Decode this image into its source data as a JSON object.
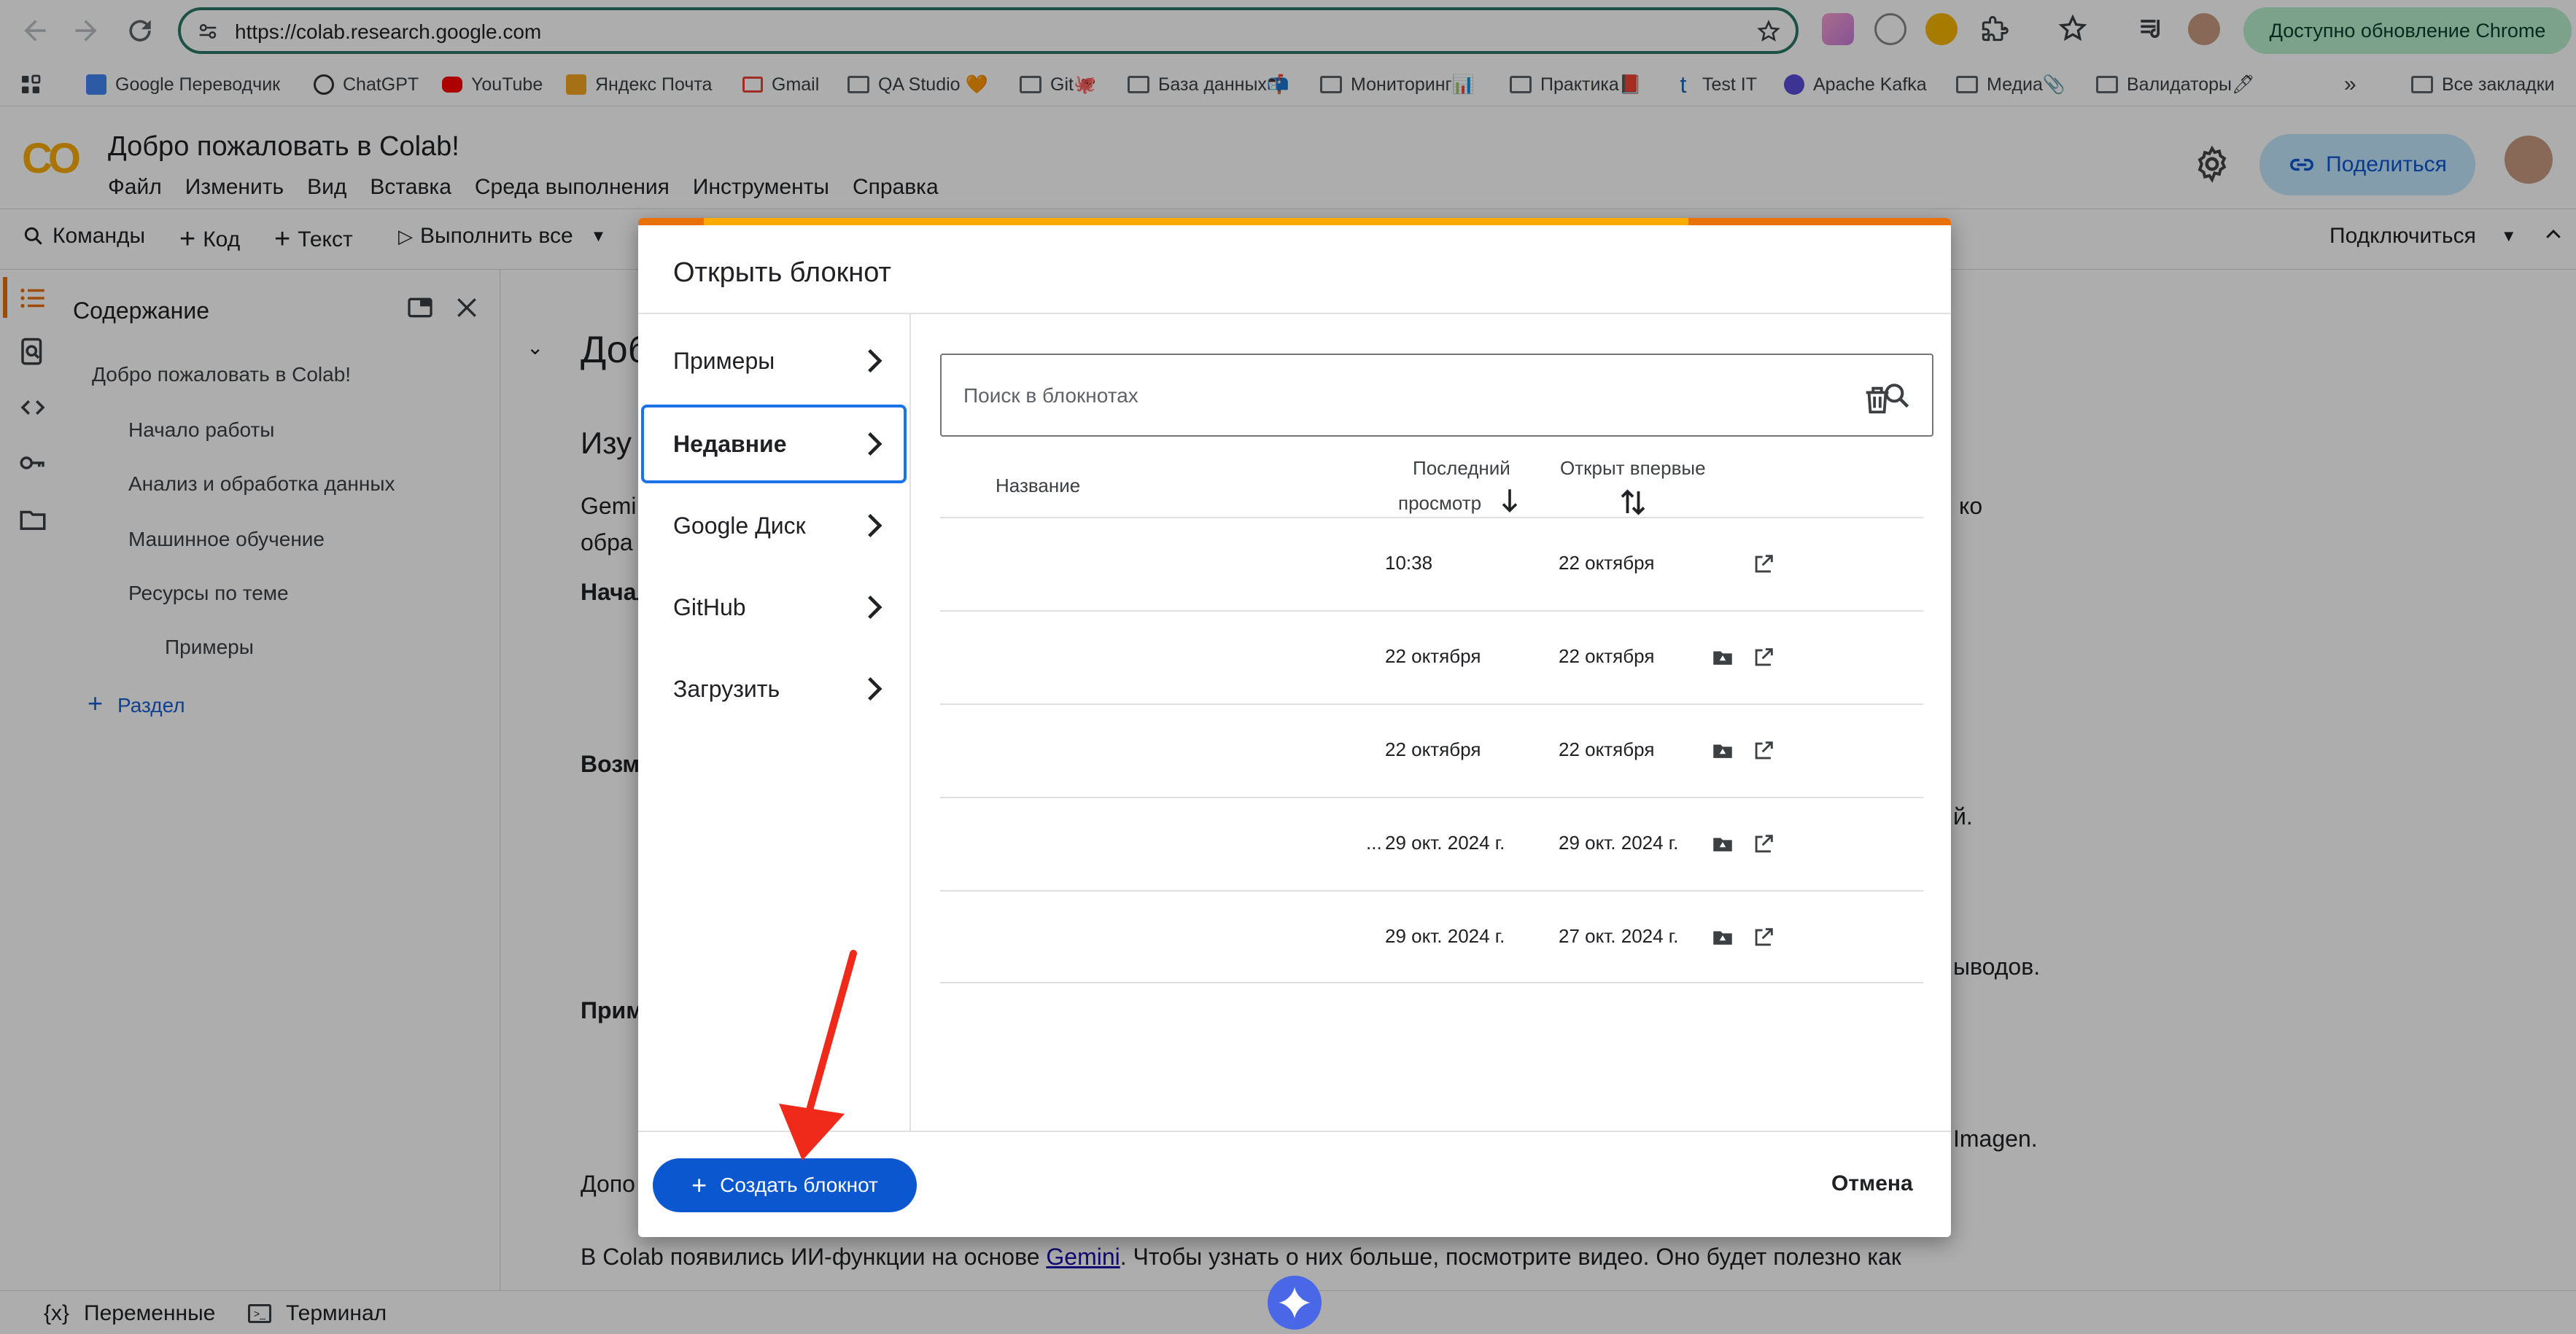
{
  "browser": {
    "url": "https://colab.research.google.com",
    "update_label": "Доступно обновление Chrome"
  },
  "bookmarks": {
    "items": [
      "Google Переводчик",
      "ChatGPT",
      "YouTube",
      "Яндекс Почта",
      "Gmail",
      "QA Studio 🧡",
      "Git🐙",
      "База данных📬",
      "Мониторинг📊",
      "Практика📕",
      "Test IT",
      "Apache Kafka",
      "Медиа📎",
      "Валидаторы🖊"
    ],
    "more": "»",
    "all": "Все закладки"
  },
  "colab": {
    "title": "Добро пожаловать в Colab!",
    "menu": [
      "Файл",
      "Изменить",
      "Вид",
      "Вставка",
      "Среда выполнения",
      "Инструменты",
      "Справка"
    ],
    "share_label": "Поделиться",
    "toolbar": {
      "commands": "Команды",
      "code": "Код",
      "text": "Текст",
      "run_all": "Выполнить все",
      "connect": "Подключиться"
    },
    "toc": {
      "title": "Содержание",
      "items": [
        "Добро пожаловать в Colab!",
        "Начало работы",
        "Анализ и обработка данных",
        "Машинное обучение",
        "Ресурсы по теме",
        "Примеры"
      ],
      "add_section": "Раздел"
    },
    "content": {
      "heading_partial": "Доб",
      "sub_partial": "Изу",
      "p1_a": "Gemi",
      "p1_b": "обра",
      "p1_right": "ко",
      "nach": "Начало",
      "vozm": "Возм",
      "prim": "Прим",
      "dopo": "Допо",
      "r1": "й.",
      "r2": "ыводов.",
      "r3": "Imagen.",
      "bottom_pre": "В Colab появились ИИ-функции на основе ",
      "bottom_link": "Gemini",
      "bottom_post": ". Чтобы узнать о них больше, посмотрите видео. Оно будет полезно как"
    },
    "status": {
      "variables": "Переменные",
      "terminal": "Терминал"
    }
  },
  "dialog": {
    "title": "Открыть блокнот",
    "nav": [
      "Примеры",
      "Недавние",
      "Google Диск",
      "GitHub",
      "Загрузить"
    ],
    "active_nav": "Недавние",
    "search_placeholder": "Поиск в блокнотах",
    "columns": {
      "name": "Название",
      "last_line1": "Последний",
      "last_line2": "просмотр",
      "first": "Открыт впервые"
    },
    "rows": [
      {
        "name": "",
        "last": "10:38",
        "first": "22 октября",
        "drive": false
      },
      {
        "name": "",
        "last": "22 октября",
        "first": "22 октября",
        "drive": true
      },
      {
        "name": "",
        "last": "22 октября",
        "first": "22 октября",
        "drive": true
      },
      {
        "name": "...",
        "last": "29 окт. 2024 г.",
        "first": "29 окт. 2024 г.",
        "drive": true
      },
      {
        "name": "",
        "last": "29 окт. 2024 г.",
        "first": "27 окт. 2024 г.",
        "drive": true
      }
    ],
    "create_label": "Создать блокнот",
    "cancel_label": "Отмена"
  },
  "colors": {
    "accent": "#0b57d0",
    "arrow": "#f02a1a",
    "colab_orange": "#f9ab00"
  }
}
